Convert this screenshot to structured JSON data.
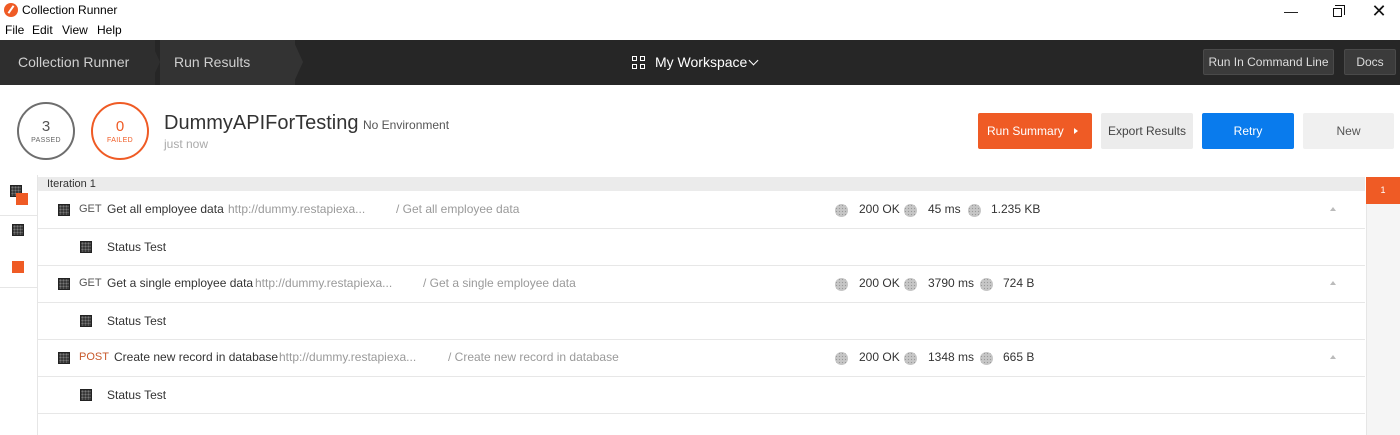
{
  "window": {
    "title": "Collection Runner",
    "controls": {
      "minimize": "—",
      "close": "✕"
    }
  },
  "menu": [
    "File",
    "Edit",
    "View",
    "Help"
  ],
  "header": {
    "breadcrumbs": [
      "Collection Runner",
      "Run Results"
    ],
    "workspace": "My Workspace",
    "run_cli_label": "Run In Command Line",
    "docs_label": "Docs"
  },
  "summary": {
    "passed_count": "3",
    "passed_label": "PASSED",
    "failed_count": "0",
    "failed_label": "FAILED",
    "collection_name": "DummyAPIForTesting",
    "environment": "No Environment",
    "time": "just now",
    "buttons": {
      "run_summary": "Run Summary",
      "export": "Export Results",
      "retry": "Retry",
      "new": "New"
    }
  },
  "iteration": {
    "label": "Iteration 1",
    "badge": "1",
    "requests": [
      {
        "method": "GET",
        "name": "Get all employee data",
        "url": "http://dummy.restapiexa...",
        "path": "/ Get all employee data",
        "status": "200 OK",
        "time": "45 ms",
        "size": "1.235 KB",
        "test": "Status Test"
      },
      {
        "method": "GET",
        "name": "Get a single employee data",
        "url": "http://dummy.restapiexa...",
        "path": "/ Get a single employee data",
        "status": "200 OK",
        "time": "3790 ms",
        "size": "724 B",
        "test": "Status Test"
      },
      {
        "method": "POST",
        "name": "Create new record in database",
        "url": "http://dummy.restapiexa...",
        "path": "/ Create new record in database",
        "status": "200 OK",
        "time": "1348 ms",
        "size": "665 B",
        "test": "Status Test"
      }
    ]
  },
  "colors": {
    "accent_orange": "#ef5b25",
    "retry_blue": "#097bed",
    "header_dark": "#262626"
  }
}
